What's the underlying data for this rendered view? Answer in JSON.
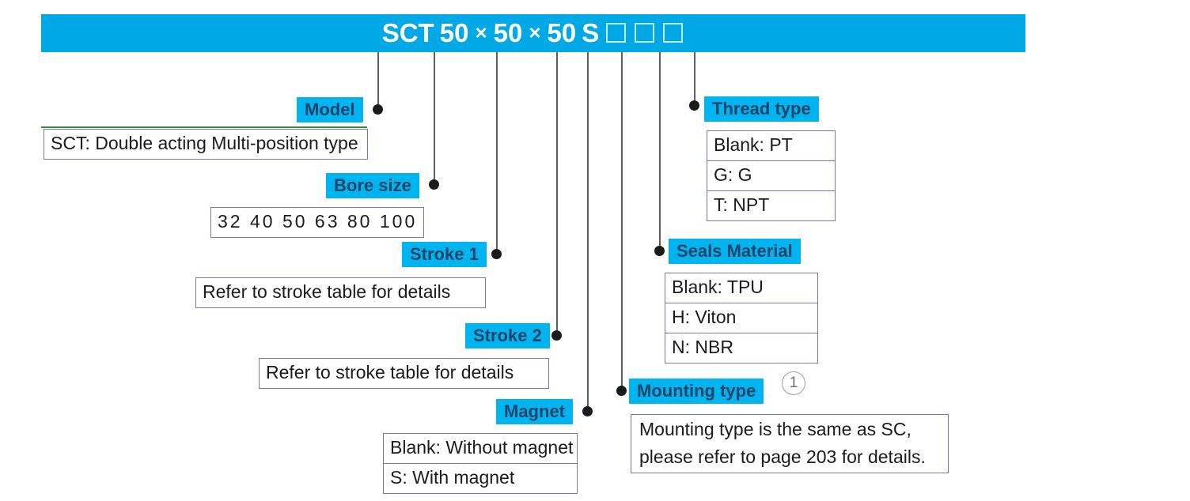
{
  "banner": {
    "model_prefix": "SCT",
    "bore": "50",
    "mult1": "×",
    "stroke1": "50",
    "mult2": "×",
    "stroke2": "50",
    "magnet": "S",
    "squares": 3,
    "background_color": "#00a8e6",
    "text_color": "#ffffff"
  },
  "accent_color": "#00b5ef",
  "tag_text_color": "#18436b",
  "box_border_color": "#6f7bb0",
  "sections": {
    "model": {
      "tag": "Model",
      "rows": [
        "SCT: Double acting Multi-position type"
      ]
    },
    "bore_size": {
      "tag": "Bore size",
      "rows": [
        "32  40  50  63  80  100"
      ],
      "values": [
        "32",
        "40",
        "50",
        "63",
        "80",
        "100"
      ]
    },
    "stroke_1": {
      "tag": "Stroke 1",
      "rows": [
        "Refer to stroke table for details"
      ]
    },
    "stroke_2": {
      "tag": "Stroke 2",
      "rows": [
        "Refer to stroke table for details"
      ]
    },
    "magnet": {
      "tag": "Magnet",
      "rows": [
        "Blank: Without magnet",
        "S: With magnet"
      ]
    },
    "thread_type": {
      "tag": "Thread type",
      "rows": [
        "Blank: PT",
        "G: G",
        "T: NPT"
      ]
    },
    "seals_material": {
      "tag": "Seals Material",
      "rows": [
        "Blank: TPU",
        "H: Viton",
        "N: NBR"
      ]
    },
    "mounting_type": {
      "tag": "Mounting type",
      "note_marker": "1",
      "rows_line1": "Mounting type is the same as SC,",
      "rows_line2": "please refer to page 203 for details."
    }
  }
}
